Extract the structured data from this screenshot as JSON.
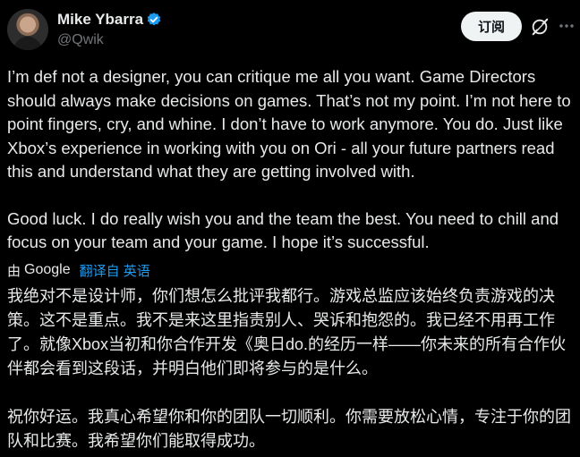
{
  "header": {
    "name": "Mike Ybarra",
    "handle": "@Qwik",
    "subscribe_label": "订阅",
    "verified_color": "#1d9bf0"
  },
  "post": {
    "paragraphs": [
      "I’m def not a designer, you can critique me all you want. Game Directors should always make decisions on games. That’s not my point. I’m not here to point fingers, cry, and whine. I don’t have to work anymore. You do. Just like Xbox’s experience in working with you on Ori - all your future partners read this and understand what they are getting involved with.",
      "Good luck. I do really wish you and the team the best. You need to chill and focus on your team and your game. I hope it’s successful."
    ]
  },
  "translation": {
    "by_label": "由",
    "provider": "Google",
    "from_label": "翻译自 英语",
    "link_color": "#1d9bf0",
    "paragraphs": [
      "我绝对不是设计师，你们想怎么批评我都行。游戏总监应该始终负责游戏的决策。这不是重点。我不是来这里指责别人、哭诉和抱怨的。我已经不用再工作了。就像Xbox当初和你合作开发《奥日do.的经历一样——你未来的所有合作伙伴都会看到这段话，并明白他们即将参与的是什么。",
      "祝你好运。我真心希望你和你的团队一切顺利。你需要放松心情，专注于你的团队和比赛。我希望你们能取得成功。"
    ]
  }
}
